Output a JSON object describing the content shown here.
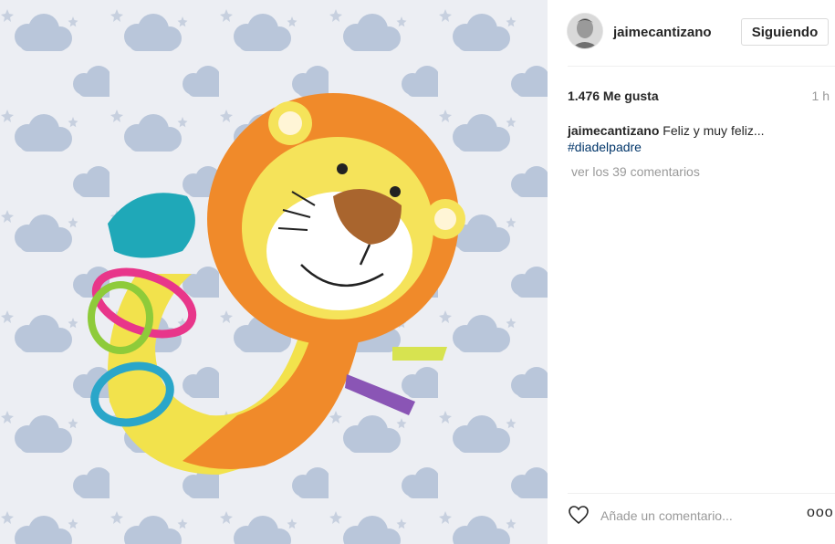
{
  "post": {
    "username": "jaimecantizano",
    "follow_label": "Siguiendo",
    "likes": "1.476 Me gusta",
    "time": "1 h",
    "caption_user": "jaimecantizano",
    "caption_text": "Feliz y muy feliz...",
    "hashtag": "#diadelpadre",
    "view_comments": "ver los 39 comentarios",
    "comment_placeholder": "Añade un comentario...",
    "more_label": "ooo"
  },
  "photo": {
    "subject": "lion-baby-rattle-toy",
    "background": "cloud-pattern-blanket"
  },
  "colors": {
    "hashtag": "#003569",
    "muted": "#999999",
    "text": "#262626",
    "border": "#dbdbdb"
  }
}
